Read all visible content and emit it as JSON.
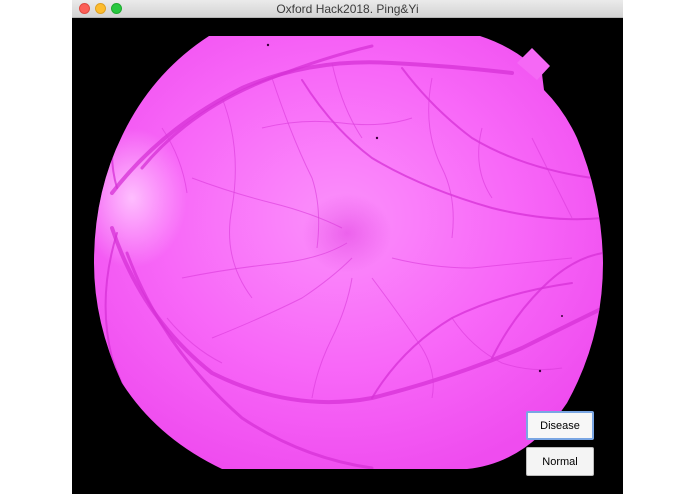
{
  "window": {
    "title": "Oxford Hack2018. Ping&Yi"
  },
  "image": {
    "description_icon": "retina-fundus-image",
    "tint_color": "#f65ff6",
    "background_color": "#000000"
  },
  "buttons": {
    "disease_label": "Disease",
    "normal_label": "Normal"
  },
  "colors": {
    "focus_ring": "#7aa6e3"
  }
}
